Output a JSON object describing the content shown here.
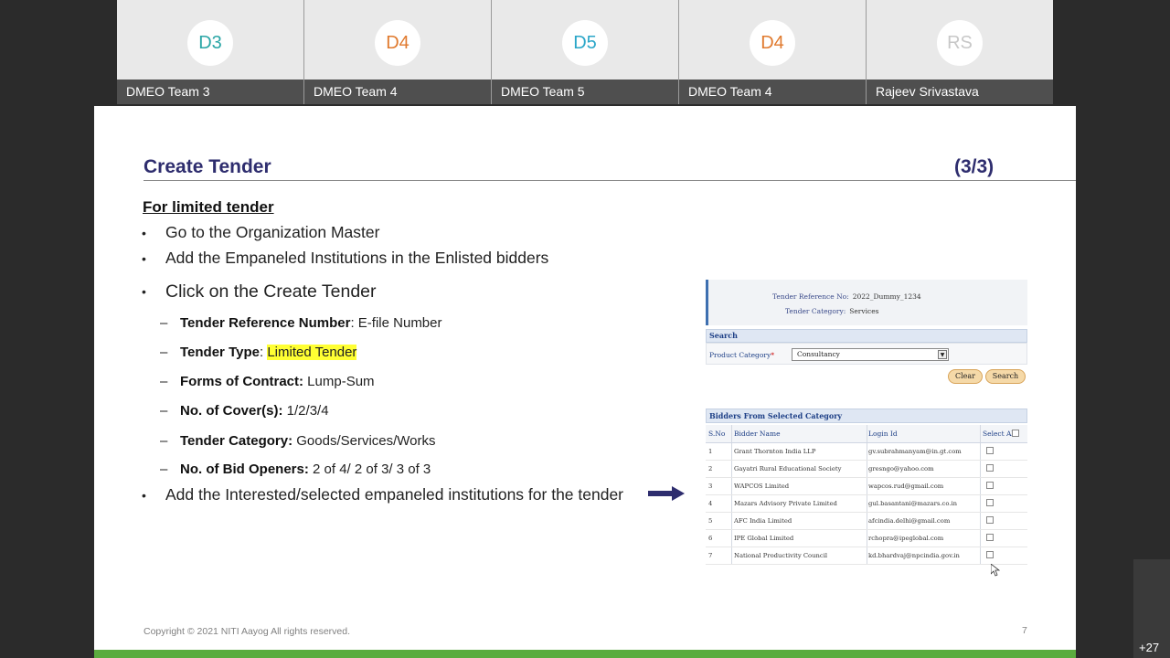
{
  "participants": [
    {
      "initials": "D3",
      "name": "DMEO Team 3",
      "color": "#2aa6a6"
    },
    {
      "initials": "D4",
      "name": "DMEO Team 4",
      "color": "#e07a2e"
    },
    {
      "initials": "D5",
      "name": "DMEO Team 5",
      "color": "#2aa6c8"
    },
    {
      "initials": "D4",
      "name": "DMEO Team 4",
      "color": "#e07a2e"
    },
    {
      "initials": "RS",
      "name": "Rajeev Srivastava",
      "color": "#c8c8c8"
    }
  ],
  "more_participants": "+27",
  "slide": {
    "title": "Create Tender",
    "page_indicator": "(3/3)",
    "subheading": "For limited tender",
    "bullets": [
      "Go to the Organization Master",
      "Add the Empaneled Institutions in the Enlisted bidders",
      "Click on the Create Tender",
      "Add the Interested/selected empaneled institutions for the tender"
    ],
    "sub_items": [
      {
        "label": "Tender Reference Number",
        "sep": ": ",
        "value": "E-file Number",
        "highlight": false
      },
      {
        "label": "Tender Type",
        "sep": ": ",
        "value": "Limited Tender",
        "highlight": true
      },
      {
        "label": "Forms of Contract:",
        "sep": " ",
        "value": "Lump-Sum",
        "highlight": false
      },
      {
        "label": "No. of Cover(s):",
        "sep": " ",
        "value": "1/2/3/4",
        "highlight": false
      },
      {
        "label": "Tender Category:",
        "sep": " ",
        "value": "Goods/Services/Works",
        "highlight": false
      },
      {
        "label": "No. of Bid Openers:",
        "sep": " ",
        "value": "2 of 4/ 2 of 3/ 3 of 3",
        "highlight": false
      }
    ],
    "footer": "Copyright © 2021 NITI Aayog All rights reserved.",
    "page_number": "7",
    "accent_color": "#2e2d6e",
    "bar_color": "#5aac3e"
  },
  "screenshot": {
    "tender_ref_label": "Tender Reference No:",
    "tender_ref_value": "2022_Dummy_1234",
    "tender_cat_label": "Tender Category:",
    "tender_cat_value": "Services",
    "search_title": "Search",
    "product_category_label": "Product Category",
    "product_category_value": "Consultancy",
    "clear_label": "Clear",
    "search_label": "Search",
    "bidders_title": "Bidders From Selected Category",
    "columns": [
      "S.No",
      "Bidder Name",
      "Login Id",
      "Select All"
    ],
    "rows": [
      {
        "sno": "1",
        "name": "Grant Thornton India LLP",
        "login": "gv.subrahmanyam@in.gt.com"
      },
      {
        "sno": "2",
        "name": "Gayatri Rural Educational Society",
        "login": "gresngo@yahoo.com"
      },
      {
        "sno": "3",
        "name": "WAPCOS Limited",
        "login": "wapcos.rud@gmail.com"
      },
      {
        "sno": "4",
        "name": "Mazars Advisory Private Limited",
        "login": "gul.basantani@mazars.co.in"
      },
      {
        "sno": "5",
        "name": "AFC India Limited",
        "login": "afcindia.delhi@gmail.com"
      },
      {
        "sno": "6",
        "name": "IPE Global Limited",
        "login": "rchopra@ipeglobal.com"
      },
      {
        "sno": "7",
        "name": "National Productivity Council",
        "login": "kd.bhardvaj@npcindia.gov.in"
      }
    ]
  }
}
